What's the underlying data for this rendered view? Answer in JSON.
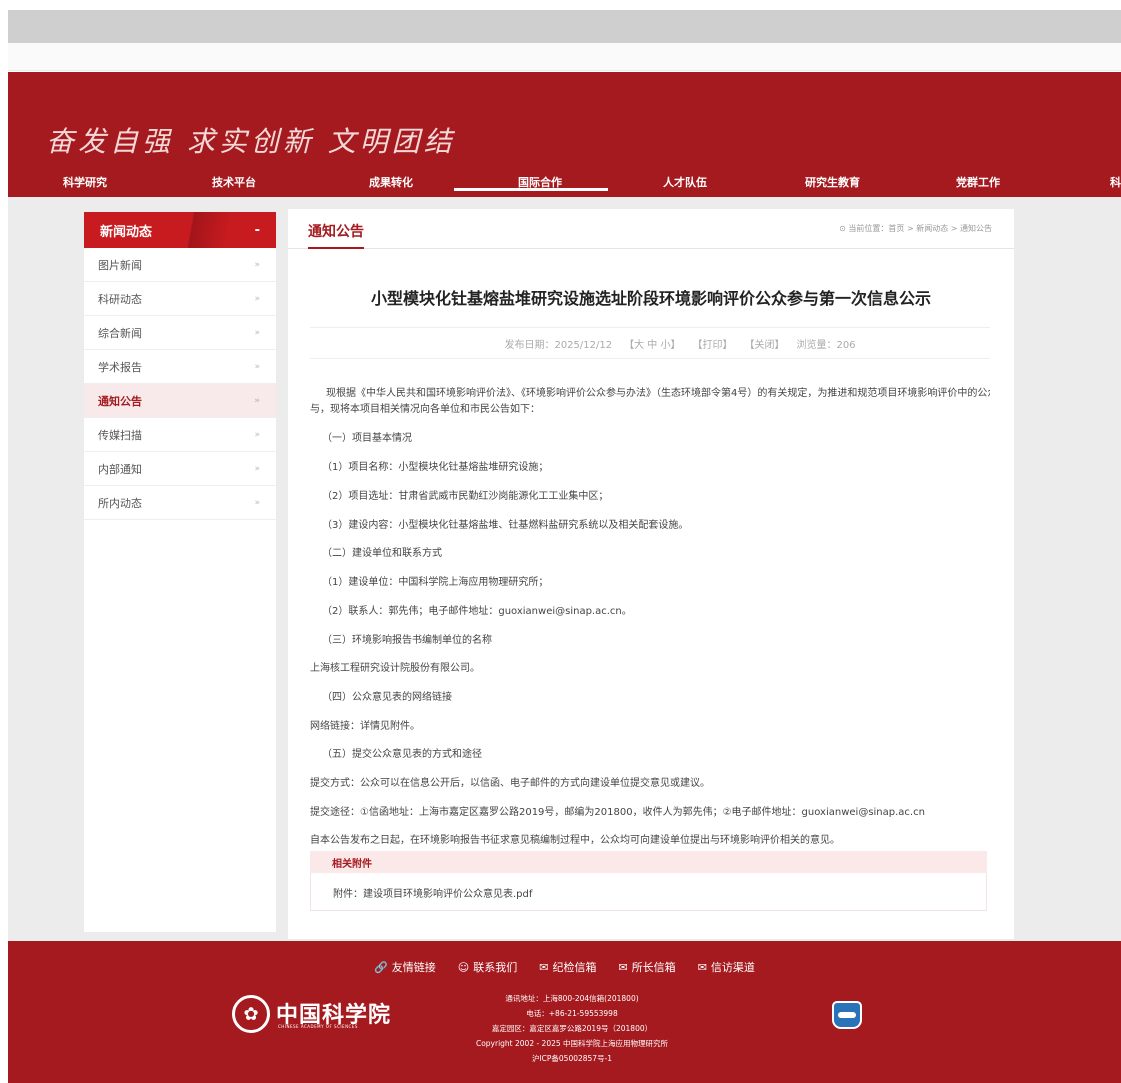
{
  "header": {
    "motto": "奋发自强 求实创新 文明团结"
  },
  "nav": {
    "items": [
      "科学研究",
      "技术平台",
      "成果转化",
      "国际合作",
      "人才队伍",
      "研究生教育",
      "党群工作",
      "科"
    ],
    "active": "国际合作"
  },
  "sidebar": {
    "title": "新闻动态",
    "collapse": "-",
    "arrow": "»",
    "items": [
      "图片新闻",
      "科研动态",
      "综合新闻",
      "学术报告",
      "通知公告",
      "传媒扫描",
      "内部通知",
      "所内动态"
    ],
    "active": "通知公告"
  },
  "main": {
    "section_title": "通知公告",
    "breadcrumb": "当前位置：首页 > 新闻动态 > 通知公告",
    "article_title": "小型模块化钍基熔盐堆研究设施选址阶段环境影响评价公众参与第一次信息公示",
    "meta": {
      "date": "发布日期：2025/12/12",
      "font_size": "【大 中 小】",
      "print": "【打印】",
      "close": "【关闭】",
      "views": "浏览量：206"
    },
    "paragraphs": [
      "现根据《中华人民共和国环境影响评价法》、《环境影响评价公众参与办法》（生态环境部令第4号）的有关规定，为推进和规范项目环境影响评价中的公众参",
      "与，现将本项目相关情况向各单位和市民公告如下：",
      "（一）项目基本情况",
      "（1）项目名称：小型模块化钍基熔盐堆研究设施；",
      "（2）项目选址：甘肃省武威市民勤红沙岗能源化工工业集中区；",
      "（3）建设内容：小型模块化钍基熔盐堆、钍基燃料盐研究系统以及相关配套设施。",
      "（二）建设单位和联系方式",
      "（1）建设单位：中国科学院上海应用物理研究所；",
      "（2）联系人：郭先伟；电子邮件地址：guoxianwei@sinap.ac.cn。",
      "（三）环境影响报告书编制单位的名称",
      "上海核工程研究设计院股份有限公司。",
      "（四）公众意见表的网络链接",
      "网络链接：详情见附件。",
      "（五）提交公众意见表的方式和途径",
      "提交方式：公众可以在信息公开后，以信函、电子邮件的方式向建设单位提交意见或建议。",
      "提交途径：①信函地址：上海市嘉定区嘉罗公路2019号，邮编为201800，收件人为郭先伟；②电子邮件地址：guoxianwei@sinap.ac.cn",
      "自本公告发布之日起，在环境影响报告书征求意见稿编制过程中，公众均可向建设单位提出与环境影响评价相关的意见。"
    ],
    "attachments_title": "相关附件",
    "attachment": "附件：建设项目环境影响评价公众意见表.pdf"
  },
  "footer": {
    "links": [
      {
        "icon": "link-icon",
        "glyph": "🔗",
        "label": "友情链接"
      },
      {
        "icon": "contact-icon",
        "glyph": "☺",
        "label": "联系我们"
      },
      {
        "icon": "mail-icon",
        "glyph": "✉",
        "label": "纪检信箱"
      },
      {
        "icon": "mail-icon",
        "glyph": "✉",
        "label": "所长信箱"
      },
      {
        "icon": "mail-icon",
        "glyph": "✉",
        "label": "信访渠道"
      }
    ],
    "org_name": "中国科学院",
    "org_name_en": "CHINESE ACADEMY OF SCIENCES",
    "info": [
      "通讯地址：上海800-204信箱(201800)",
      "电话：+86-21-59553998",
      "嘉定园区：嘉定区嘉罗公路2019号（201800）",
      "Copyright 2002 - 2025 中国科学院上海应用物理研究所",
      "沪ICP备05002857号-1"
    ]
  }
}
